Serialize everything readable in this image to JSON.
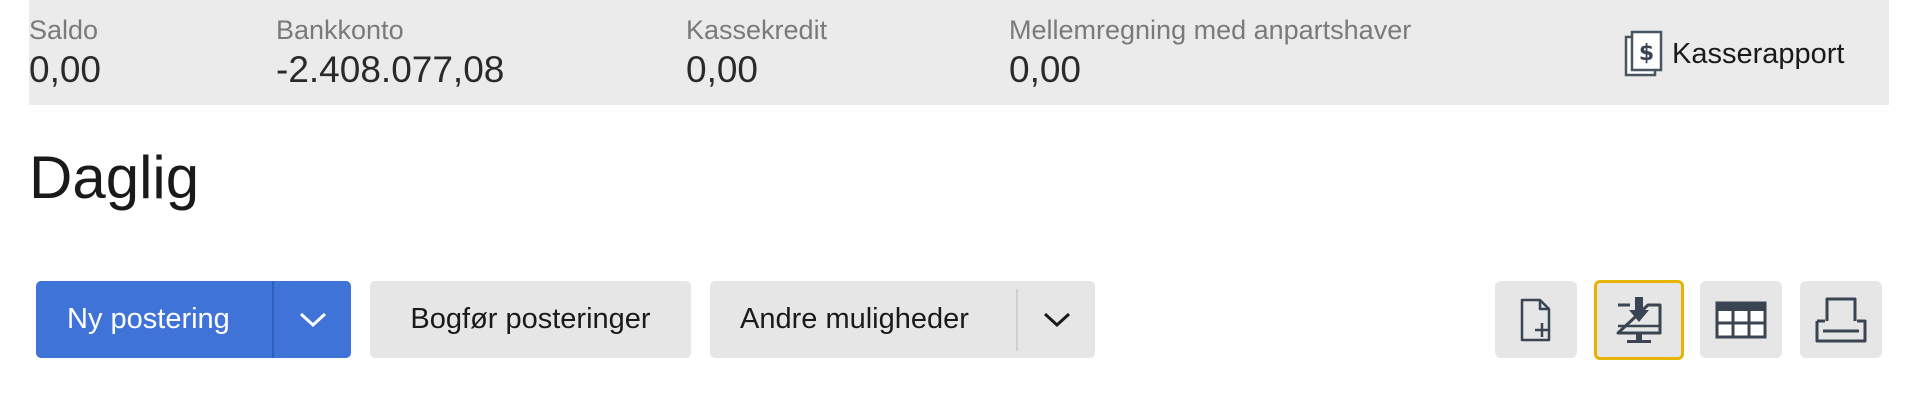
{
  "summary": {
    "saldo": {
      "label": "Saldo",
      "value": "0,00"
    },
    "bankkonto": {
      "label": "Bankkonto",
      "value": "-2.408.077,08"
    },
    "kassekredit": {
      "label": "Kassekredit",
      "value": "0,00"
    },
    "mellemregning": {
      "label": "Mellemregning med anpartshaver",
      "value": "0,00"
    },
    "report_link": {
      "label": "Kasserapport",
      "icon": "dollar-document-icon"
    }
  },
  "page": {
    "title": "Daglig"
  },
  "toolbar": {
    "new_entry_label": "Ny postering",
    "post_entries_label": "Bogfør posteringer",
    "more_options_label": "Andre muligheder",
    "icon_buttons": [
      "new-document-icon",
      "import-icon",
      "grid-view-icon",
      "print-icon"
    ]
  },
  "colors": {
    "primary": "#3f73d8",
    "summary_bg": "#ebebeb",
    "button_bg": "#e6e6e6",
    "focus_outline": "#e6b400",
    "icon": "#4a5563"
  }
}
